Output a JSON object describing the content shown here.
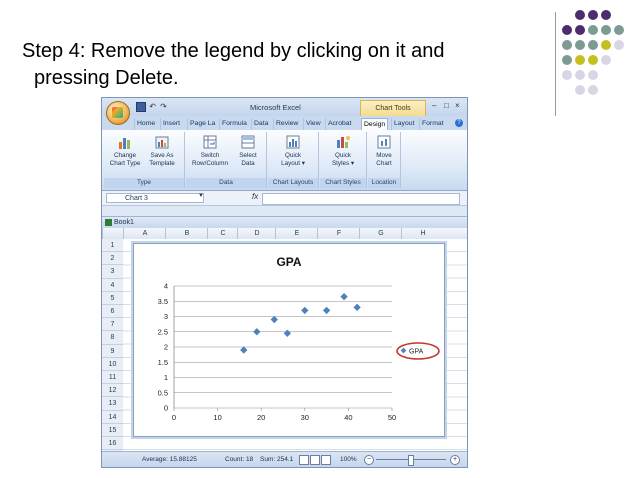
{
  "slide": {
    "title": "Step 4: Remove the legend by clicking on it and pressing Delete."
  },
  "excel": {
    "app_title": "Microsoft Excel",
    "context_tab": "Chart Tools",
    "window_controls": [
      "–",
      "□",
      "×"
    ],
    "tabs": [
      "Home",
      "Insert",
      "Page La",
      "Formula",
      "Data",
      "Review",
      "View",
      "Acrobat",
      "Design",
      "Layout",
      "Format"
    ],
    "active_tab": "Design",
    "ribbon": {
      "buttons": [
        {
          "label1": "Change",
          "label2": "Chart Type",
          "icon": "chart-type-icon"
        },
        {
          "label1": "Save As",
          "label2": "Template",
          "icon": "save-template-icon"
        },
        {
          "label1": "Switch",
          "label2": "Row/Column",
          "icon": "switch-row-column-icon"
        },
        {
          "label1": "Select",
          "label2": "Data",
          "icon": "select-data-icon"
        },
        {
          "label1": "Quick",
          "label2": "Layout ▾",
          "icon": "quick-layout-icon"
        },
        {
          "label1": "Quick",
          "label2": "Styles ▾",
          "icon": "quick-styles-icon"
        },
        {
          "label1": "Move",
          "label2": "Chart",
          "icon": "move-chart-icon"
        }
      ],
      "groups": [
        "Type",
        "Data",
        "Chart Layouts",
        "Chart Styles",
        "Location"
      ]
    },
    "name_box": "Chart 3",
    "fx": "fx",
    "workbook": "Book1",
    "columns": [
      "A",
      "B",
      "C",
      "D",
      "E",
      "F",
      "G",
      "H"
    ],
    "rows": [
      "1",
      "2",
      "3",
      "4",
      "5",
      "6",
      "7",
      "8",
      "9",
      "10",
      "11",
      "12",
      "13",
      "14",
      "15",
      "16"
    ],
    "status": {
      "average": "Average: 15.88125",
      "count": "Count: 18",
      "sum": "Sum: 254.1",
      "zoom": "100%"
    }
  },
  "chart_data": {
    "type": "scatter",
    "title": "GPA",
    "xlabel": "",
    "ylabel": "",
    "xlim": [
      0,
      50
    ],
    "ylim": [
      0,
      4
    ],
    "x_ticks": [
      "0",
      "10",
      "20",
      "30",
      "40",
      "50"
    ],
    "y_ticks": [
      "0",
      "0.5",
      "1",
      "1.5",
      "2",
      "2.5",
      "3",
      "3.5",
      "4"
    ],
    "grid": true,
    "legend": "right",
    "legend_highlight_color": "#c0392b",
    "marker_color": "#4f81bd",
    "series": [
      {
        "name": "GPA",
        "x": [
          16,
          19,
          23,
          26,
          30,
          35,
          39,
          42
        ],
        "y": [
          1.9,
          2.5,
          2.9,
          2.45,
          3.2,
          3.2,
          3.65,
          3.3
        ]
      }
    ]
  },
  "decoration": {
    "colors": [
      "#4b2c6f",
      "#7c9c93",
      "#c4c01f",
      "#d6d6e6"
    ]
  }
}
